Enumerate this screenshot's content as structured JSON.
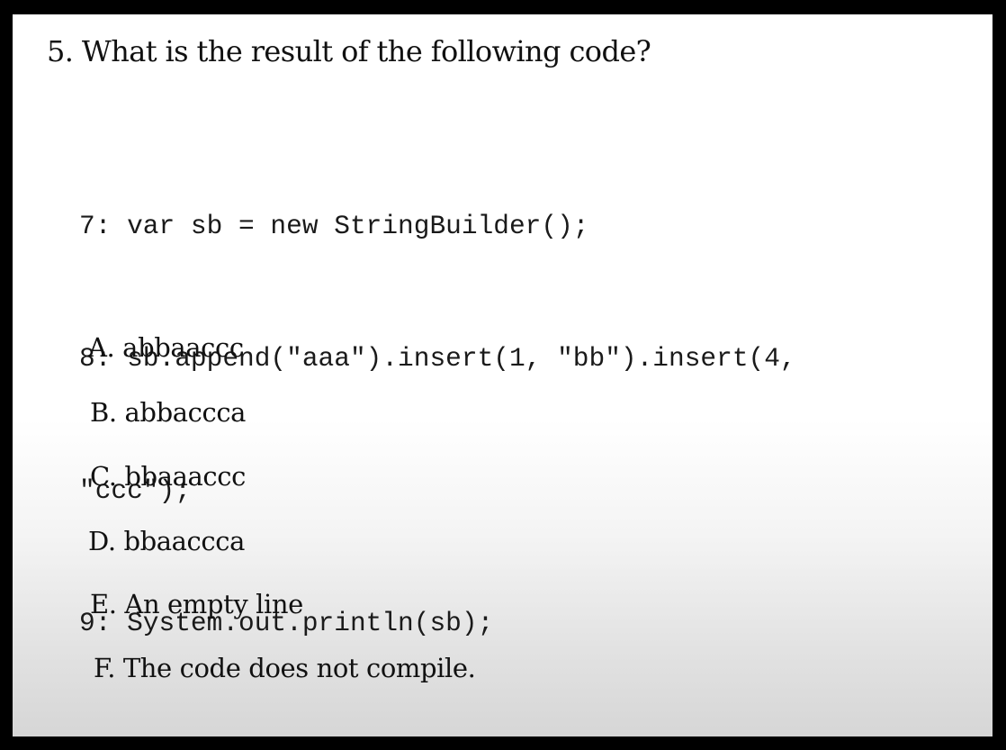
{
  "question": {
    "number": "5.",
    "text": "What is the result of the following code?"
  },
  "code": {
    "lines": [
      "7: var sb = new StringBuilder();",
      "8: sb.append(\"aaa\").insert(1, \"bb\").insert(4,",
      "\"ccc\");",
      "9: System.out.println(sb);"
    ]
  },
  "options": [
    "A. abbaaccc",
    "B. abbaccca",
    "C. bbaaaccc",
    "D. bbaaccca",
    "E. An empty line",
    "F. The code does not compile."
  ]
}
